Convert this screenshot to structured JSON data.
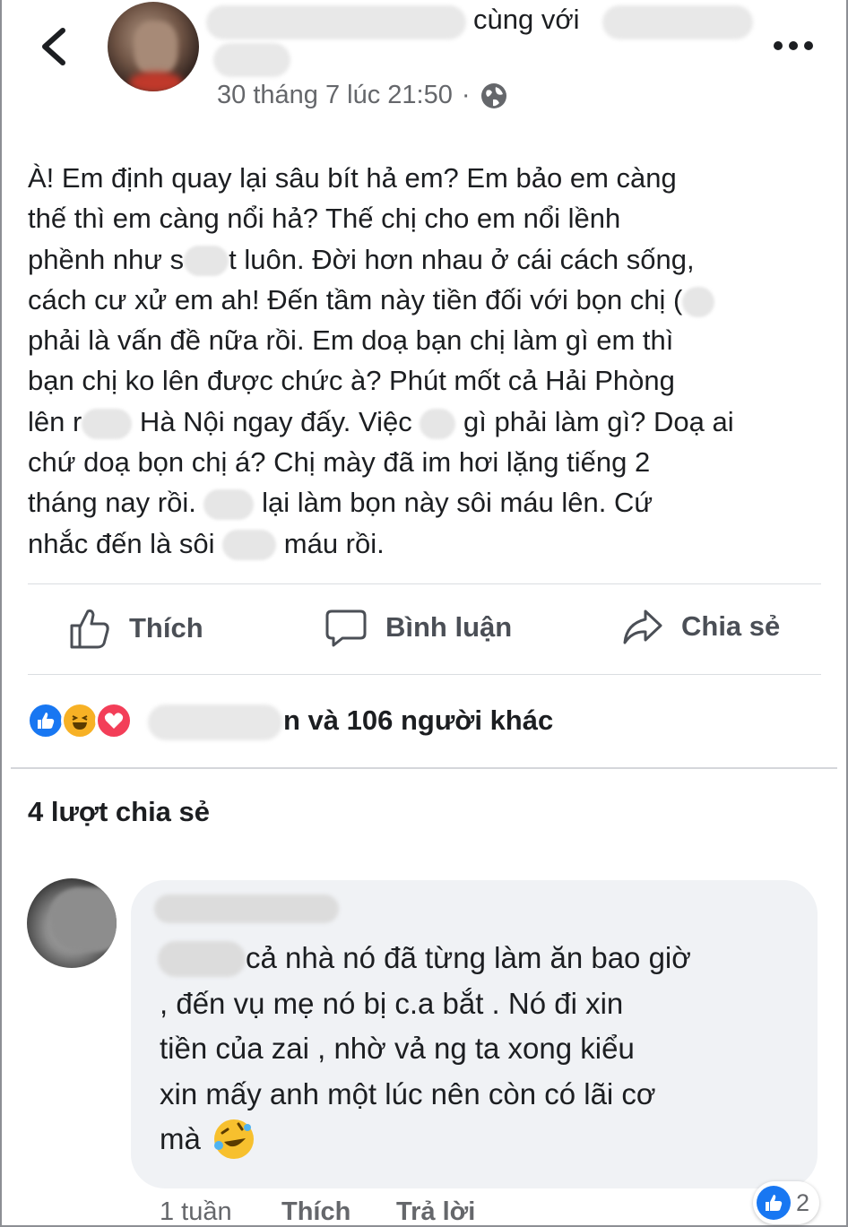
{
  "header": {
    "with_text": "cùng với",
    "timestamp": "30 tháng 7 lúc 21:50",
    "separator": "·",
    "audience_icon": "globe-icon",
    "back_icon": "chevron-left-icon",
    "more_icon": "more-horizontal-icon"
  },
  "post": {
    "lines": [
      [
        "À! Em định quay lại sâu bít hả em? Em bảo em càng"
      ],
      [
        "thế thì em càng nổi hả? Thế chị cho em nổi lềnh"
      ],
      [
        "phềnh như s",
        "",
        "t luôn. Đời hơn nhau ở cái cách sống,"
      ],
      [
        "cách cư xử em ah! Đến tầm này tiền đối với bọn chị (",
        ""
      ],
      [
        "phải là vấn đề nữa rồi. Em doạ bạn chị làm gì em thì"
      ],
      [
        "bạn chị ko lên được chức à? Phút mốt cả Hải Phòng"
      ],
      [
        "lên r",
        "",
        " Hà Nội ngay đấy. Việc ",
        "",
        " gì phải làm gì? Doạ ai"
      ],
      [
        "chứ doạ bọn chị á? Chị mày đã im hơi lặng tiếng 2"
      ],
      [
        "tháng nay rồi. ",
        "",
        " lại làm bọn này sôi máu lên. Cứ"
      ],
      [
        "nhắc đến là sôi ",
        "",
        " máu rồi."
      ]
    ]
  },
  "actions": {
    "like_label": "Thích",
    "comment_label": "Bình luận",
    "share_label": "Chia sẻ"
  },
  "reactions": {
    "summary_text": "n và 106 người khác",
    "icons": [
      "like-reaction-icon",
      "haha-reaction-icon",
      "love-reaction-icon"
    ],
    "colors": {
      "like": "#1877f2",
      "haha": "#f7b125",
      "love": "#f33e58"
    }
  },
  "shares": {
    "label": "4 lượt chia sẻ"
  },
  "comment": {
    "text_lines": [
      "cả nhà nó đã từng làm ăn bao giờ",
      ", đến vụ mẹ nó bị c.a bắt . Nó đi xin",
      "tiền của zai , nhờ vả ng ta xong kiểu",
      "xin mấy anh một lúc nên còn có lãi cơ",
      "mà"
    ],
    "prefix": "D",
    "emoji": "rolling-on-floor-laughing-emoji",
    "time": "1 tuần",
    "like_label": "Thích",
    "reply_label": "Trả lời",
    "like_count": "2"
  }
}
